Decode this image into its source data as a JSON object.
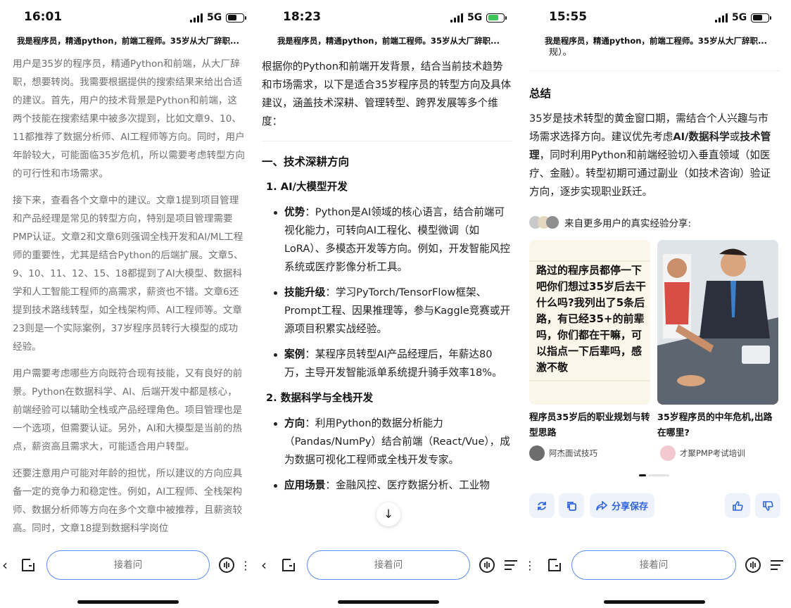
{
  "conv_title": "我是程序员，精通python，前端工程师。35岁从大厂辞职...",
  "panel1": {
    "time": "16:01",
    "network": "5G",
    "paragraphs": [
      "用户是35岁的程序员，精通Python和前端，从大厂辞职，想要转岗。我需要根据提供的搜索结果来给出合适的建议。首先，用户的技术背景是Python和前端，这两个技能在搜索结果中被多次提到，比如文章9、10、11都推荐了数据分析师、AI工程师等方向。同时，用户年龄较大，可能面临35岁危机，所以需要考虑转型方向的可行性和市场需求。",
      "接下来，查看各个文章中的建议。文章1提到项目管理和产品经理是常见的转型方向，特别是项目管理需要PMP认证。文章2和文章6则强调全栈开发和AI/ML工程师的重要性，尤其是结合Python的后端扩展。文章5、9、10、11、12、15、18都提到了AI大模型、数据科学和人工智能工程师的高需求，薪资也不错。文章6还提到技术路线转型，如全栈架构师、AI工程师等。文章23则是一个实际案例，37岁程序员转行大模型的成功经验。",
      "用户需要考虑哪些方向既符合现有技能，又有良好的前景。Python在数据科学、AI、后端开发中都是核心，前端经验可以辅助全栈或产品经理角色。项目管理也是一个选项，但需要认证。另外，AI和大模型是当前的热点，薪资高且需求大，可能适合用户转型。",
      "还要注意用户可能对年龄的担忧，所以建议的方向应具备一定的竞争力和稳定性。例如，AI工程师、全栈架构师、数据分析师等方向在多个文章中被推荐，且薪资较高。同时，文章18提到数据科学岗位"
    ],
    "input_placeholder": "接着问"
  },
  "panel2": {
    "time": "18:23",
    "network": "5G",
    "intro": "根据你的Python和前端开发背景，结合当前技术趋势和市场需求，以下是适合35岁程序员的转型方向及具体建议，涵盖技术深耕、管理转型、跨界发展等多个维度：",
    "section1": "一、技术深耕方向",
    "sub1": "1. AI/大模型开发",
    "sub1_bullets": [
      {
        "label": "优势",
        "text": "：Python是AI领域的核心语言，结合前端可视化能力，可转向AI工程化、模型微调（如LoRA）、多模态开发等方向。例如，开发智能风控系统或医疗影像分析工具。"
      },
      {
        "label": "技能升级",
        "text": "：学习PyTorch/TensorFlow框架、Prompt工程、因果推理等，参与Kaggle竞赛或开源项目积累实战经验。"
      },
      {
        "label": "案例",
        "text": "：某程序员转型AI产品经理后，年薪达80万，主导开发智能派单系统提升骑手效率18%。"
      }
    ],
    "sub2": "2. 数据科学与全栈开发",
    "sub2_bullets": [
      {
        "label": "方向",
        "text": "：利用Python的数据分析能力（Pandas/NumPy）结合前端（React/Vue），成为数据可视化工程师或全栈开发专家。"
      },
      {
        "label": "应用场景",
        "text": "：金融风控、医疗数据分析、工业物"
      }
    ],
    "input_placeholder": "接着问"
  },
  "panel3": {
    "time": "15:55",
    "network": "5G",
    "top_fragment": "规）。",
    "summary_title": "总结",
    "summary_parts": {
      "a": "35岁是技术转型的黄金窗口期，需结合个人兴趣与市场需求选择方向。建议优先考虑",
      "b": "AI/数据科学",
      "c": "或",
      "d": "技术管理",
      "e": "，同时利用Python和前端经验切入垂直领域（如医疗、金融）。转型初期可通过副业（如技术咨询）验证方向，逐步实现职业跃迁。"
    },
    "share_label": "来自更多用户的真实经验分享:",
    "card1_text": "路过的程序员都停一下吧你们想过35岁后去干什么吗?我列出了5条后路，有已经35+的前辈吗，你们都在干嘛，可以指点一下后辈吗，感激不敬",
    "card1_caption": "程序员35岁后的职业规划与转型思路",
    "card1_author": "阿杰面试技巧",
    "card2_caption": "35岁程序员的中年危机,出路在哪里?",
    "card2_author": "才聚PMP考试培训",
    "share_button": "分享保存",
    "input_placeholder": "接着问"
  },
  "colors": {
    "accent": "#2f64e0",
    "input_border": "#5b8cf5",
    "think_text": "#707070",
    "battery_charge": "#3ec55a"
  }
}
